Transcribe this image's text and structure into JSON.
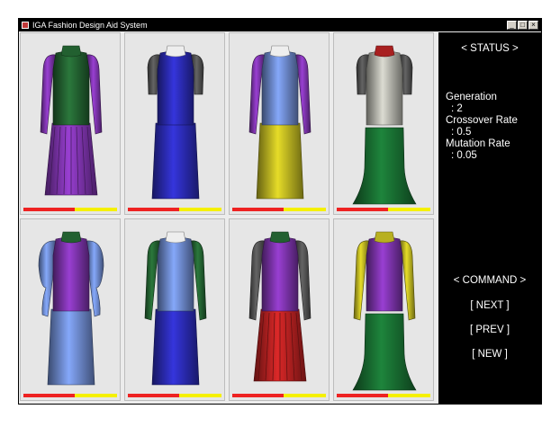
{
  "window": {
    "title": "IGA Fashion Design Aid System",
    "controls": [
      "_",
      "□",
      "×"
    ]
  },
  "status": {
    "heading": "< STATUS >",
    "generation_label": "Generation",
    "generation_value": ": 2",
    "crossover_label": "Crossover Rate",
    "crossover_value": ": 0.5",
    "mutation_label": "Mutation Rate",
    "mutation_value": ": 0.05"
  },
  "command": {
    "heading": "< COMMAND >",
    "next_label": "[ NEXT ]",
    "prev_label": "[ PREV ]",
    "new_label": "[ NEW  ]"
  },
  "designs": [
    {
      "sleeve": "long",
      "skirt": "pleated",
      "sleeveColor": "#7a32a8",
      "bodyColor": "#226030",
      "skirtColor": "#7a32a8",
      "collar": "#226030",
      "fitness": 0.55
    },
    {
      "sleeve": "short",
      "skirt": "straight",
      "sleeveColor": "#505050",
      "bodyColor": "#2a2ab0",
      "skirtColor": "#2a2ab0",
      "collar": "#eeeeee",
      "fitness": 0.55
    },
    {
      "sleeve": "long",
      "skirt": "straight",
      "sleeveColor": "#7a32a8",
      "bodyColor": "#6a86c8",
      "skirtColor": "#b8b020",
      "collar": "#eeeeee",
      "fitness": 0.55
    },
    {
      "sleeve": "short",
      "skirt": "mermaid",
      "sleeveColor": "#505050",
      "bodyColor": "#b0b0a8",
      "skirtColor": "#186a30",
      "collar": "#a82020",
      "fitness": 0.55
    },
    {
      "sleeve": "puff",
      "skirt": "straight",
      "sleeveColor": "#6a86c8",
      "bodyColor": "#7a32a8",
      "skirtColor": "#6a86c8",
      "collar": "#226030",
      "fitness": 0.55
    },
    {
      "sleeve": "long",
      "skirt": "straight",
      "sleeveColor": "#226030",
      "bodyColor": "#6a86c8",
      "skirtColor": "#2a2ab0",
      "collar": "#eeeeee",
      "fitness": 0.55
    },
    {
      "sleeve": "long",
      "skirt": "pleated",
      "sleeveColor": "#505050",
      "bodyColor": "#7a32a8",
      "skirtColor": "#b02020",
      "collar": "#226030",
      "fitness": 0.55
    },
    {
      "sleeve": "long",
      "skirt": "mermaid",
      "sleeveColor": "#b8b020",
      "bodyColor": "#7a32a8",
      "skirtColor": "#186a30",
      "collar": "#b8b020",
      "fitness": 0.55
    }
  ]
}
